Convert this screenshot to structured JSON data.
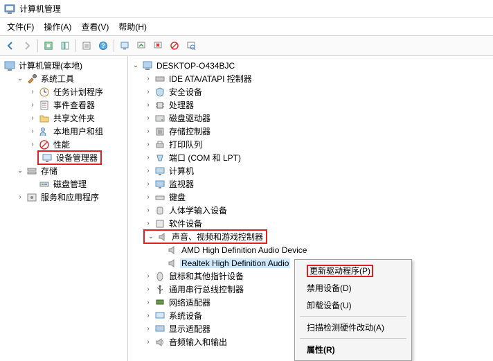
{
  "title": "计算机管理",
  "menu": {
    "file": "文件(F)",
    "action": "操作(A)",
    "view": "查看(V)",
    "help": "帮助(H)"
  },
  "left": {
    "root": "计算机管理(本地)",
    "systools": "系统工具",
    "tasksched": "任务计划程序",
    "eventviewer": "事件查看器",
    "sharedfolders": "共享文件夹",
    "localusers": "本地用户和组",
    "performance": "性能",
    "devicemgr": "设备管理器",
    "storage": "存储",
    "diskmgmt": "磁盘管理",
    "services": "服务和应用程序"
  },
  "right": {
    "root": "DESKTOP-O434BJC",
    "ide": "IDE ATA/ATAPI 控制器",
    "security": "安全设备",
    "cpu": "处理器",
    "diskdrv": "磁盘驱动器",
    "storctrl": "存储控制器",
    "printq": "打印队列",
    "ports": "端口 (COM 和 LPT)",
    "computers": "计算机",
    "monitors": "监视器",
    "keyboards": "键盘",
    "hid": "人体学输入设备",
    "softdev": "软件设备",
    "sound": "声音、视频和游戏控制器",
    "amd": "AMD High Definition Audio Device",
    "realtek": "Realtek High Definition Audio",
    "mouse": "鼠标和其他指针设备",
    "usb": "通用串行总线控制器",
    "network": "网络适配器",
    "sysdev": "系统设备",
    "display": "显示适配器",
    "audioio": "音频输入和输出"
  },
  "ctx": {
    "update": "更新驱动程序(P)",
    "disable": "禁用设备(D)",
    "uninstall": "卸载设备(U)",
    "scan": "扫描检测硬件改动(A)",
    "props": "属性(R)"
  }
}
